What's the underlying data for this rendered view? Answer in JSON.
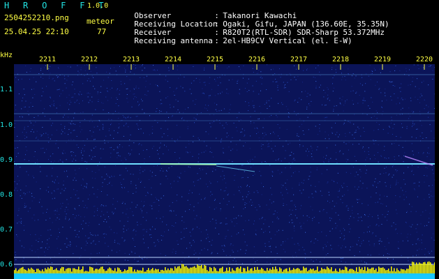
{
  "header": {
    "brand": "H R O F F T",
    "version": "1.0.0",
    "filename": "2504252210.png",
    "meteor_label": "meteor",
    "datetime": "25.04.25 22:10",
    "meteor_count": "77"
  },
  "meta": {
    "observer_key": "Observer",
    "observer_val": "Takanori Kawachi",
    "location_key": "Receiving Location",
    "location_val": "Ogaki, Gifu, JAPAN (136.60E, 35.35N)",
    "receiver_key": "Receiver",
    "receiver_val": "R820T2(RTL-SDR) SDR-Sharp 53.372MHz",
    "antenna_key": "Receiving antenna",
    "antenna_val": "2el-HB9CV Vertical (el. E-W)",
    "separator": ":"
  },
  "axes": {
    "y_unit": "kHz",
    "y_ticks": [
      "1.1",
      "1.0",
      "0.9",
      "0.8",
      "0.7",
      "0.6"
    ],
    "x_ticks": [
      "2211",
      "2212",
      "2213",
      "2214",
      "2215",
      "2216",
      "2217",
      "2218",
      "2219",
      "2220"
    ]
  },
  "colors": {
    "background": "#000000",
    "label": "#22e6e6",
    "count": "#ffff44",
    "spectrogram": "#0b1458",
    "signal": "#6fe0ff",
    "amplitude": "#ffff00"
  }
}
